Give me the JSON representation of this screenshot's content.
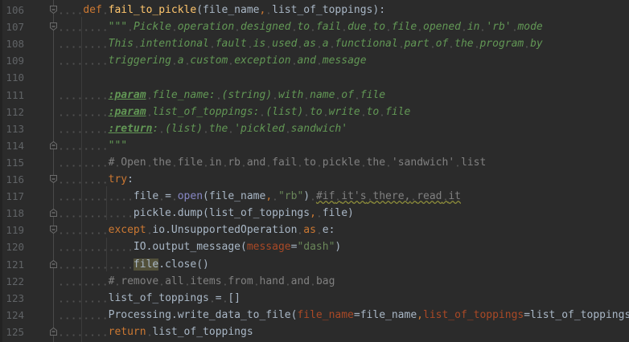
{
  "editor": {
    "colors": {
      "background": "#2b2b2b",
      "keyword": "#cc7832",
      "function": "#ffc66d",
      "docstring": "#629755",
      "comment": "#808080",
      "string": "#6a8759",
      "builtin": "#8888c6",
      "kwarg": "#aa4926"
    },
    "lines": [
      {
        "number": "106",
        "fold": "start",
        "tokens": [
          [
            "    ",
            "ws"
          ],
          [
            "def",
            "kw"
          ],
          [
            " ",
            "ws"
          ],
          [
            "fail_to_pickle",
            "fn"
          ],
          [
            "(file_name",
            "p"
          ],
          [
            ",",
            "kw"
          ],
          [
            " ",
            "ws"
          ],
          [
            "list_of_toppings):",
            "p"
          ]
        ]
      },
      {
        "number": "107",
        "fold": "start",
        "tokens": [
          [
            "        ",
            "ws"
          ],
          [
            "\"\"\" Pickle operation designed to fail due to file opened in 'rb' mode",
            "doc"
          ]
        ]
      },
      {
        "number": "108",
        "fold": "",
        "tokens": [
          [
            "        ",
            "ws"
          ],
          [
            "This intentional fault is used as a functional part of the program by",
            "doc"
          ]
        ]
      },
      {
        "number": "109",
        "fold": "",
        "tokens": [
          [
            "        ",
            "ws"
          ],
          [
            "triggering a custom exception and message",
            "doc"
          ]
        ]
      },
      {
        "number": "110",
        "fold": "",
        "tokens": []
      },
      {
        "number": "111",
        "fold": "",
        "tokens": [
          [
            "        ",
            "ws"
          ],
          [
            ":param",
            "tag"
          ],
          [
            " file_name: (string) with name of file",
            "doc"
          ]
        ]
      },
      {
        "number": "112",
        "fold": "",
        "tokens": [
          [
            "        ",
            "ws"
          ],
          [
            ":param",
            "tag"
          ],
          [
            " list_of_toppings: (list) to write to file",
            "doc"
          ]
        ]
      },
      {
        "number": "113",
        "fold": "",
        "tokens": [
          [
            "        ",
            "ws"
          ],
          [
            ":return",
            "tag"
          ],
          [
            ": (list) the 'pickled sandwich'",
            "doc"
          ]
        ]
      },
      {
        "number": "114",
        "fold": "end",
        "tokens": [
          [
            "        ",
            "ws"
          ],
          [
            "\"\"\"",
            "doc"
          ]
        ]
      },
      {
        "number": "115",
        "fold": "",
        "tokens": [
          [
            "        ",
            "ws"
          ],
          [
            "# Open the file in rb and fail to pickle the 'sandwich' list",
            "cm"
          ]
        ]
      },
      {
        "number": "116",
        "fold": "start",
        "tokens": [
          [
            "        ",
            "ws"
          ],
          [
            "try",
            "kw"
          ],
          [
            ":",
            "p"
          ]
        ]
      },
      {
        "number": "117",
        "fold": "",
        "tokens": [
          [
            "            ",
            "ws"
          ],
          [
            "file = ",
            "p"
          ],
          [
            "open",
            "bi"
          ],
          [
            "(file_name",
            "p"
          ],
          [
            ",",
            "kw"
          ],
          [
            " ",
            "ws"
          ],
          [
            "\"rb\"",
            "str"
          ],
          [
            ")",
            "p"
          ],
          [
            " ",
            "ws"
          ],
          [
            "#if it's there, read it",
            "cmw"
          ]
        ]
      },
      {
        "number": "118",
        "fold": "end",
        "tokens": [
          [
            "            ",
            "ws"
          ],
          [
            "pickle.dump(list_of_toppings",
            "p"
          ],
          [
            ",",
            "kw"
          ],
          [
            " ",
            "ws"
          ],
          [
            "file)",
            "p"
          ]
        ]
      },
      {
        "number": "119",
        "fold": "start",
        "tokens": [
          [
            "        ",
            "ws"
          ],
          [
            "except",
            "kw"
          ],
          [
            " ",
            "ws"
          ],
          [
            "io.UnsupportedOperation",
            "p"
          ],
          [
            " ",
            "ws"
          ],
          [
            "as",
            "kw"
          ],
          [
            " ",
            "ws"
          ],
          [
            "e:",
            "p"
          ]
        ]
      },
      {
        "number": "120",
        "fold": "",
        "tokens": [
          [
            "            ",
            "ws"
          ],
          [
            "IO.output_message(",
            "p"
          ],
          [
            "message",
            "kwarg"
          ],
          [
            "=",
            "p"
          ],
          [
            "\"dash\"",
            "str"
          ],
          [
            ")",
            "p"
          ]
        ]
      },
      {
        "number": "121",
        "fold": "end",
        "tokens": [
          [
            "            ",
            "ws"
          ],
          [
            "file",
            "hl"
          ],
          [
            ".close()",
            "p"
          ]
        ]
      },
      {
        "number": "122",
        "fold": "",
        "tokens": [
          [
            "        ",
            "ws"
          ],
          [
            "# remove all items from hand and bag",
            "cm"
          ]
        ]
      },
      {
        "number": "123",
        "fold": "",
        "tokens": [
          [
            "        ",
            "ws"
          ],
          [
            "list_of_toppings = []",
            "p"
          ]
        ]
      },
      {
        "number": "124",
        "fold": "",
        "tokens": [
          [
            "        ",
            "ws"
          ],
          [
            "Processing.write_data_to_file(",
            "p"
          ],
          [
            "file_name",
            "kwarg"
          ],
          [
            "=file_name",
            "p"
          ],
          [
            ",",
            "kw"
          ],
          [
            "list_of_toppings",
            "kwarg"
          ],
          [
            "=list_of_toppings)",
            "p"
          ]
        ]
      },
      {
        "number": "125",
        "fold": "end",
        "tokens": [
          [
            "        ",
            "ws"
          ],
          [
            "return",
            "kw"
          ],
          [
            " ",
            "ws"
          ],
          [
            "list_of_toppings",
            "p"
          ]
        ]
      }
    ]
  }
}
